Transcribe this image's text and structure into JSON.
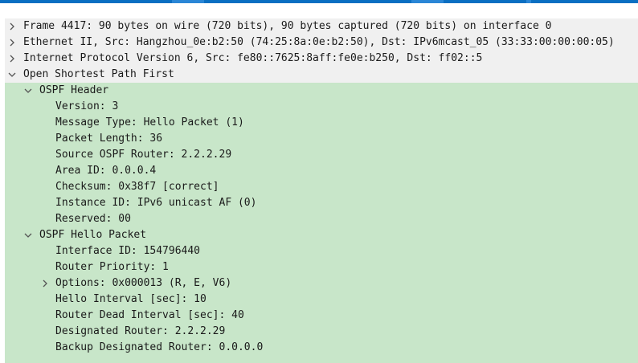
{
  "tree": {
    "frame": "Frame 4417: 90 bytes on wire (720 bits), 90 bytes captured (720 bits) on interface 0",
    "ethernet": "Ethernet II, Src: Hangzhou_0e:b2:50 (74:25:8a:0e:b2:50), Dst: IPv6mcast_05 (33:33:00:00:00:05)",
    "ipv6": "Internet Protocol Version 6, Src: fe80::7625:8aff:fe0e:b250, Dst: ff02::5",
    "ospf": "Open Shortest Path First",
    "ospf_header": {
      "label": "OSPF Header",
      "version": "Version: 3",
      "message_type": "Message Type: Hello Packet (1)",
      "packet_length": "Packet Length: 36",
      "source_router": "Source OSPF Router: 2.2.2.29",
      "area_id": "Area ID: 0.0.0.4",
      "checksum": "Checksum: 0x38f7 [correct]",
      "instance_id": "Instance ID: IPv6 unicast AF (0)",
      "reserved": "Reserved: 00"
    },
    "ospf_hello": {
      "label": "OSPF Hello Packet",
      "interface_id": "Interface ID: 154796440",
      "router_priority": "Router Priority: 1",
      "options": "Options: 0x000013 (R, E, V6)",
      "hello_interval": "Hello Interval [sec]: 10",
      "dead_interval": "Router Dead Interval [sec]: 40",
      "designated_router": "Designated Router: 2.2.2.29",
      "backup_designated_router": "Backup Designated Router: 0.0.0.0"
    }
  },
  "colors": {
    "expanded_pane": "#c8e6c9",
    "collapsed_row": "#f0f0f0",
    "title_bar": "#0a6fc2"
  }
}
